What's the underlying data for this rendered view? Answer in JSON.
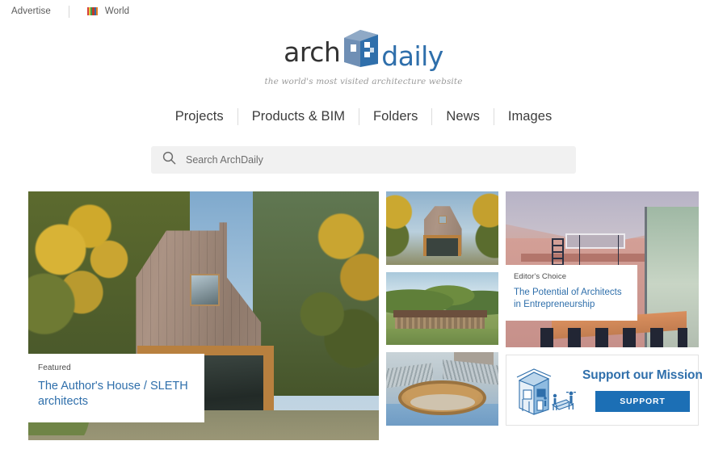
{
  "topbar": {
    "advertise_label": "Advertise",
    "world_label": "World",
    "flag_colors": [
      "#d94040",
      "#d9d040",
      "#3f9a4f",
      "#c0392b",
      "#2f6fab",
      "#e67e22"
    ]
  },
  "brand": {
    "logo_text_left": "arch",
    "logo_text_right": "daily",
    "logo_icon": "archdaily-building-icon",
    "tagline": "the world's most visited architecture website",
    "color_dark": "#333333",
    "color_blue": "#2f6fab"
  },
  "nav": {
    "items": [
      {
        "label": "Projects"
      },
      {
        "label": "Products & BIM"
      },
      {
        "label": "Folders"
      },
      {
        "label": "News"
      },
      {
        "label": "Images"
      }
    ]
  },
  "search": {
    "placeholder": "Search ArchDaily",
    "value": "",
    "icon": "search-icon"
  },
  "content": {
    "hero": {
      "kicker": "Featured",
      "title": "The Author's House / SLETH architects",
      "image_alt": "wooden gabled house among autumn trees"
    },
    "thumbnails": [
      {
        "image_alt": "wooden gabled house exterior at dusk"
      },
      {
        "image_alt": "long timber pavilion in green landscape"
      },
      {
        "image_alt": "circular wooden courtyard with tiled roofs"
      }
    ],
    "editors_choice": {
      "kicker": "Editor's Choice",
      "title": "The Potential of Architects in Entrepreneurship",
      "image_alt": "pink interior with loft ladder and pendant lamps"
    },
    "support": {
      "title": "Support our Mission",
      "button_label": "SUPPORT",
      "illustration": "house-construction-illustration",
      "button_color": "#1c6fb5"
    }
  }
}
